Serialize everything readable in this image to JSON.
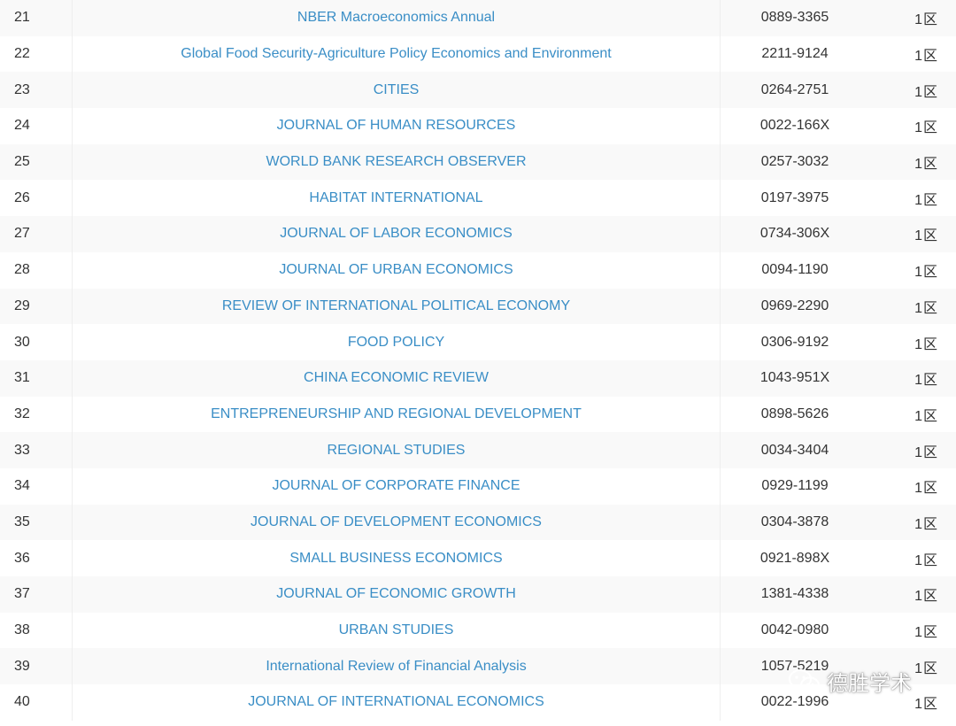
{
  "rows": [
    {
      "rank": "21",
      "title": "NBER Macroeconomics Annual",
      "issn": "0889-3365",
      "zone": "1区"
    },
    {
      "rank": "22",
      "title": "Global Food Security-Agriculture Policy Economics and Environment",
      "issn": "2211-9124",
      "zone": "1区"
    },
    {
      "rank": "23",
      "title": "CITIES",
      "issn": "0264-2751",
      "zone": "1区"
    },
    {
      "rank": "24",
      "title": "JOURNAL OF HUMAN RESOURCES",
      "issn": "0022-166X",
      "zone": "1区"
    },
    {
      "rank": "25",
      "title": "WORLD BANK RESEARCH OBSERVER",
      "issn": "0257-3032",
      "zone": "1区"
    },
    {
      "rank": "26",
      "title": "HABITAT INTERNATIONAL",
      "issn": "0197-3975",
      "zone": "1区"
    },
    {
      "rank": "27",
      "title": "JOURNAL OF LABOR ECONOMICS",
      "issn": "0734-306X",
      "zone": "1区"
    },
    {
      "rank": "28",
      "title": "JOURNAL OF URBAN ECONOMICS",
      "issn": "0094-1190",
      "zone": "1区"
    },
    {
      "rank": "29",
      "title": "REVIEW OF INTERNATIONAL POLITICAL ECONOMY",
      "issn": "0969-2290",
      "zone": "1区"
    },
    {
      "rank": "30",
      "title": "FOOD POLICY",
      "issn": "0306-9192",
      "zone": "1区"
    },
    {
      "rank": "31",
      "title": "CHINA ECONOMIC REVIEW",
      "issn": "1043-951X",
      "zone": "1区"
    },
    {
      "rank": "32",
      "title": "ENTREPRENEURSHIP AND REGIONAL DEVELOPMENT",
      "issn": "0898-5626",
      "zone": "1区"
    },
    {
      "rank": "33",
      "title": "REGIONAL STUDIES",
      "issn": "0034-3404",
      "zone": "1区"
    },
    {
      "rank": "34",
      "title": "JOURNAL OF CORPORATE FINANCE",
      "issn": "0929-1199",
      "zone": "1区"
    },
    {
      "rank": "35",
      "title": "JOURNAL OF DEVELOPMENT ECONOMICS",
      "issn": "0304-3878",
      "zone": "1区"
    },
    {
      "rank": "36",
      "title": "SMALL BUSINESS ECONOMICS",
      "issn": "0921-898X",
      "zone": "1区"
    },
    {
      "rank": "37",
      "title": "JOURNAL OF ECONOMIC GROWTH",
      "issn": "1381-4338",
      "zone": "1区"
    },
    {
      "rank": "38",
      "title": "URBAN STUDIES",
      "issn": "0042-0980",
      "zone": "1区"
    },
    {
      "rank": "39",
      "title": "International Review of Financial Analysis",
      "issn": "1057-5219",
      "zone": "1区"
    },
    {
      "rank": "40",
      "title": "JOURNAL OF INTERNATIONAL ECONOMICS",
      "issn": "0022-1996",
      "zone": "1区"
    }
  ],
  "watermark": {
    "text": "德胜学术",
    "icon": "wechat-icon"
  },
  "colors": {
    "link": "#3a8ec6",
    "text": "#333333",
    "row_stripe": "#f9f9f9",
    "row_plain": "#ffffff",
    "border": "#eeeeee"
  }
}
